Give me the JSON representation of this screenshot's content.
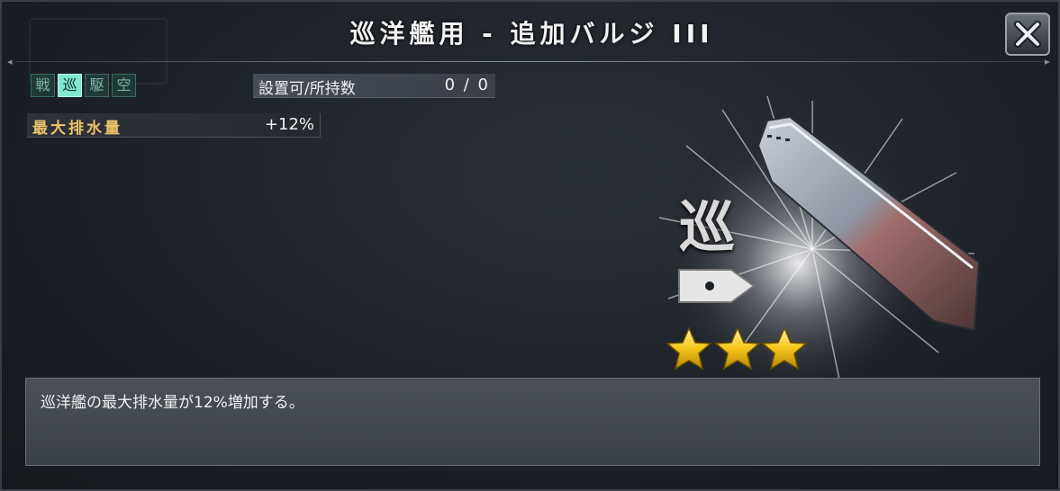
{
  "header": {
    "title": "巡洋艦用 - 追加バルジ III",
    "close_icon": "close-icon"
  },
  "ship_types": [
    {
      "label": "戦",
      "active": false
    },
    {
      "label": "巡",
      "active": true
    },
    {
      "label": "駆",
      "active": false
    },
    {
      "label": "空",
      "active": false
    }
  ],
  "holdings": {
    "label": "設置可/所持数",
    "value": "0 / 0"
  },
  "stat": {
    "label": "最大排水量",
    "value": "+12%"
  },
  "item": {
    "class_kanji": "巡",
    "icon": "armor-bulge-hull-icon",
    "rarity_stars": 3
  },
  "description": "巡洋艦の最大排水量が12%増加する。",
  "colors": {
    "accent": "#7fe8cf",
    "stat_label": "#e9c46a",
    "star": "#f5c518"
  }
}
